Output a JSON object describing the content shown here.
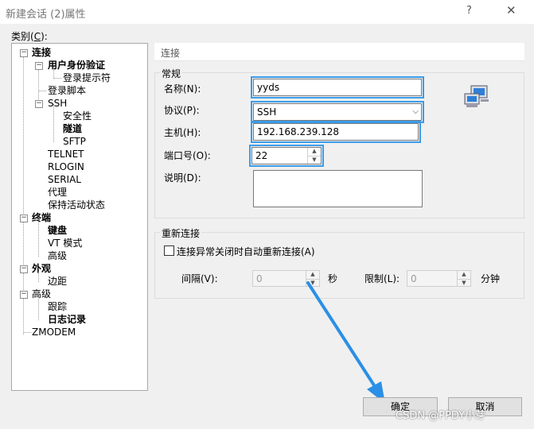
{
  "window": {
    "title": "新建会话 (2)属性",
    "help_glyph": "?",
    "close_glyph": "✕"
  },
  "category": {
    "label_prefix": "类别(",
    "label_key": "C",
    "label_suffix": "):"
  },
  "tree": {
    "connection": "连接",
    "user_auth": "用户身份验证",
    "login_prompt": "登录提示符",
    "login_script": "登录脚本",
    "ssh": "SSH",
    "security": "安全性",
    "tunnel": "隧道",
    "sftp": "SFTP",
    "telnet": "TELNET",
    "rlogin": "RLOGIN",
    "serial": "SERIAL",
    "proxy": "代理",
    "keepalive": "保持活动状态",
    "terminal": "终端",
    "keyboard": "键盘",
    "vt_mode": "VT 模式",
    "advanced_terminal": "高级",
    "appearance": "外观",
    "margin": "边距",
    "advanced": "高级",
    "trace": "跟踪",
    "logging": "日志记录",
    "zmodem": "ZMODEM"
  },
  "section_header": "连接",
  "general": {
    "group_title": "常规",
    "name_label": "名称(N):",
    "name_value": "yyds",
    "protocol_label": "协议(P):",
    "protocol_value": "SSH",
    "host_label": "主机(H):",
    "host_value": "192.168.239.128",
    "port_label": "端口号(O):",
    "port_value": "22",
    "desc_label": "说明(D):",
    "desc_value": ""
  },
  "reconnect": {
    "group_title": "重新连接",
    "checkbox_label": "连接异常关闭时自动重新连接(A)",
    "checked": false,
    "interval_label": "间隔(V):",
    "interval_value": "0",
    "interval_unit": "秒",
    "limit_label": "限制(L):",
    "limit_value": "0",
    "limit_unit": "分钟"
  },
  "buttons": {
    "ok": "确定",
    "cancel": "取消"
  },
  "watermark": "CSDN @PPDY小芽",
  "colors": {
    "highlight": "#3c9ce8",
    "arrow": "#2b8fe6"
  },
  "icons": {
    "network": "network-computers-icon"
  }
}
